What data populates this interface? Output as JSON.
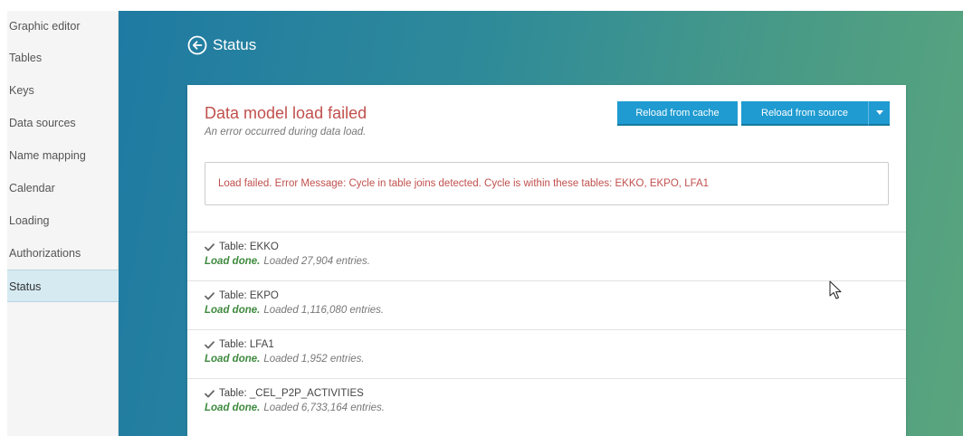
{
  "sidebar": {
    "items": [
      {
        "label": "Graphic editor"
      },
      {
        "label": "Tables"
      },
      {
        "label": "Keys"
      },
      {
        "label": "Data sources"
      },
      {
        "label": "Name mapping"
      },
      {
        "label": "Calendar"
      },
      {
        "label": "Loading"
      },
      {
        "label": "Authorizations"
      },
      {
        "label": "Status",
        "active": true
      }
    ]
  },
  "header": {
    "title": "Status",
    "back_icon": "circle-arrow-left-icon"
  },
  "card": {
    "title": "Data model load failed",
    "subtitle": "An error occurred during data load.",
    "buttons": {
      "reload_cache": "Reload from cache",
      "reload_source": "Reload from source"
    },
    "error_message": "Load failed. Error Message: Cycle in table joins detected. Cycle is within these tables: EKKO, EKPO, LFA1"
  },
  "tables": [
    {
      "name": "Table: EKKO",
      "status": "Load done.",
      "detail": "Loaded 27,904 entries."
    },
    {
      "name": "Table: EKPO",
      "status": "Load done.",
      "detail": "Loaded 1,116,080 entries."
    },
    {
      "name": "Table: LFA1",
      "status": "Load done.",
      "detail": "Loaded 1,952 entries."
    },
    {
      "name": "Table: _CEL_P2P_ACTIVITIES",
      "status": "Load done.",
      "detail": "Loaded 6,733,164 entries."
    }
  ],
  "colors": {
    "error": "#c0504d",
    "success": "#3f8a3f",
    "button": "#1f9bd1",
    "active_sidebar": "#d6eaf2"
  }
}
